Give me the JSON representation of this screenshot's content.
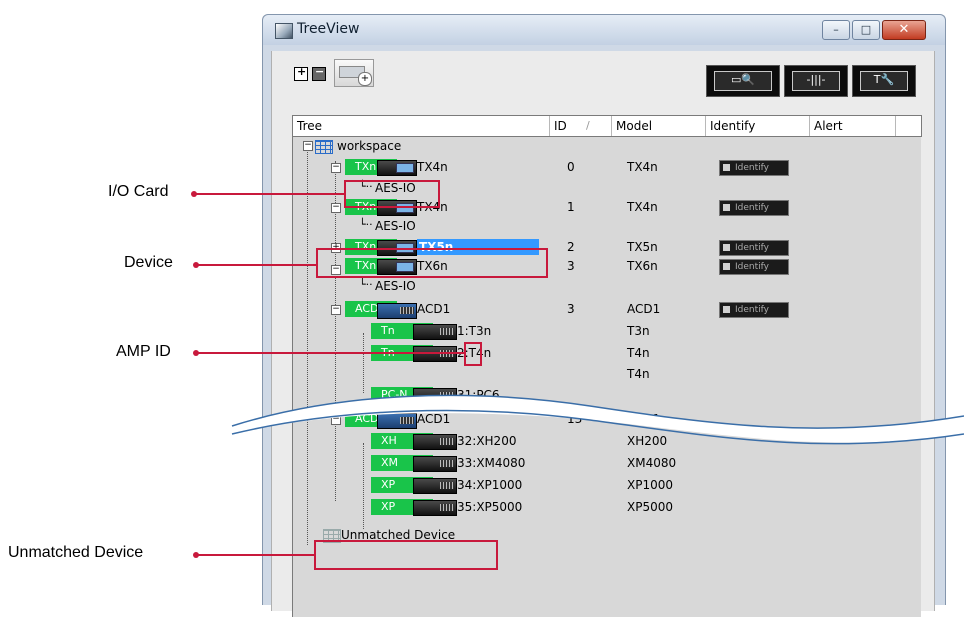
{
  "window": {
    "title": "TreeView",
    "controls": {
      "minimize": "–",
      "maximize": "□",
      "close": "✕"
    }
  },
  "toolbar": {
    "expand_icon": "expand-all-icon",
    "collapse_icon": "collapse-all-icon",
    "add_device_icon": "add-device-icon",
    "right_buttons": [
      "find-device-icon",
      "meter-icon",
      "tools-icon"
    ]
  },
  "columns": {
    "tree": "Tree",
    "id": "ID",
    "model": "Model",
    "identify": "Identify",
    "alert": "Alert",
    "sort_glyph": "/"
  },
  "tree": {
    "workspace": "workspace",
    "rows": [
      {
        "badge": "TXn",
        "name": "TX4n",
        "id": "0",
        "model": "TX4n",
        "identify": "Identify"
      },
      {
        "card": "AES-IO"
      },
      {
        "badge": "TXn",
        "name": "TX4n",
        "id": "1",
        "model": "TX4n",
        "identify": "Identify"
      },
      {
        "card": "AES-IO"
      },
      {
        "badge": "TXn",
        "name": "TX5n",
        "id": "2",
        "model": "TX5n",
        "identify": "Identify"
      },
      {
        "badge": "TXn",
        "name": "TX6n",
        "id": "3",
        "model": "TX6n",
        "identify": "Identify"
      },
      {
        "card": "AES-IO"
      },
      {
        "badge": "ACD",
        "name": "ACD1",
        "id": "3",
        "model": "ACD1",
        "identify": "Identify"
      },
      {
        "badge": "Tn",
        "name": "1:T3n",
        "model": "T3n"
      },
      {
        "badge": "Tn",
        "name": "2:T4n",
        "model": "T4n"
      },
      {
        "model": "T4n"
      },
      {
        "badge": "PC-N",
        "name": "31:PC6"
      },
      {
        "badge": "ACD",
        "name": "ACD1",
        "id": "13",
        "model": "ACD1"
      },
      {
        "badge": "XH",
        "name": "32:XH200",
        "model": "XH200"
      },
      {
        "badge": "XM",
        "name": "33:XM4080",
        "model": "XM4080"
      },
      {
        "badge": "XP",
        "name": "34:XP1000",
        "model": "XP1000"
      },
      {
        "badge": "XP",
        "name": "35:XP5000",
        "model": "XP5000"
      }
    ],
    "unmatched": "Unmatched Device"
  },
  "callouts": {
    "io_card": "I/O Card",
    "device": "Device",
    "amp_id": "AMP ID",
    "unmatched_device": "Unmatched Device"
  },
  "colors": {
    "badge_green": "#19c44a",
    "callout_red": "#c8193c",
    "selection_blue": "#3399ff"
  }
}
